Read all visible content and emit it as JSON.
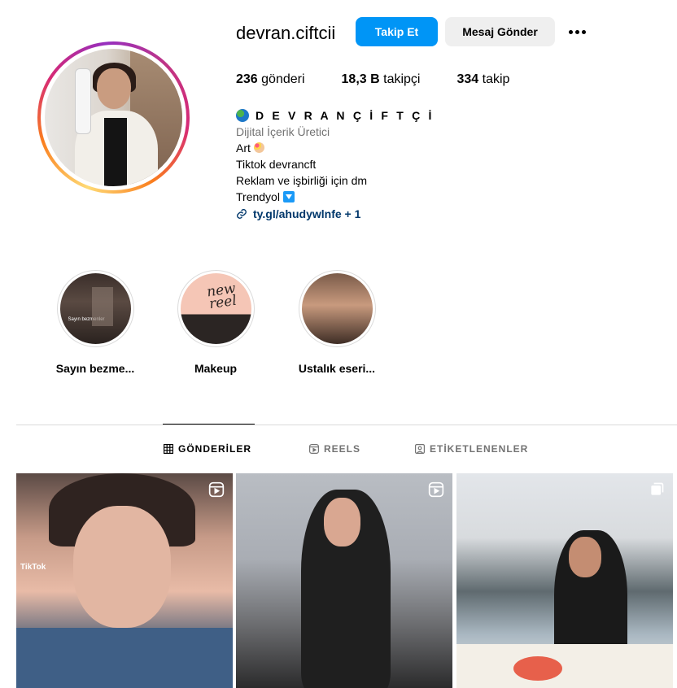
{
  "profile": {
    "username": "devran.ciftcii",
    "follow_label": "Takip Et",
    "message_label": "Mesaj Gönder",
    "more_icon": "more-horizontal-icon",
    "stats": {
      "posts_count": "236",
      "posts_label": "gönderi",
      "followers_count": "18,3 B",
      "followers_label": "takipçi",
      "following_count": "334",
      "following_label": "takip"
    },
    "bio": {
      "display_name": "D E V R A N Ç İ F T Ç İ",
      "category": "Dijital İçerik Üretici",
      "line1": "Art",
      "line2": "Tiktok devrancft",
      "line3": "Reklam ve işbirliği için dm",
      "line4": "Trendyol",
      "link": "ty.gl/ahudywlnfe + 1"
    }
  },
  "highlights": [
    {
      "label": "Sayın bezme...",
      "overlay_text": "Sayın bezmenler"
    },
    {
      "label": "Makeup",
      "overlay_text": "new reel"
    },
    {
      "label": "Ustalık eseri...",
      "overlay_text": ""
    }
  ],
  "tabs": [
    {
      "label": "GÖNDERİLER",
      "icon": "grid-icon",
      "active": true
    },
    {
      "label": "REELS",
      "icon": "reels-icon",
      "active": false
    },
    {
      "label": "ETİKETLENENLER",
      "icon": "tagged-icon",
      "active": false
    }
  ],
  "posts": [
    {
      "type_icon": "reel-icon",
      "overlay_text": "TikTok"
    },
    {
      "type_icon": "reel-icon",
      "overlay_text": ""
    },
    {
      "type_icon": "carousel-icon",
      "overlay_text": ""
    }
  ],
  "colors": {
    "primary_button": "#0095f6",
    "secondary_button": "#efefef",
    "link": "#00376b",
    "muted_text": "#737373"
  }
}
